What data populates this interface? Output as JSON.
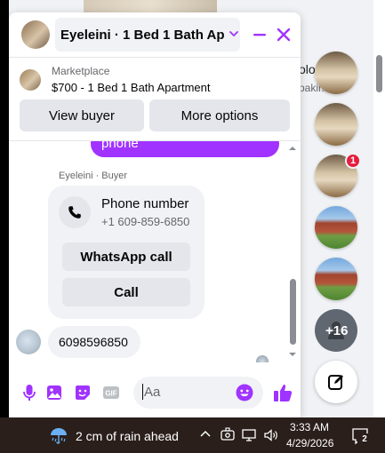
{
  "chat": {
    "title": "Eyeleini · 1 Bed 1 Bath Apa...",
    "listing_source": "Marketplace",
    "listing_title": "$700 - 1 Bed 1 Bath Apartment",
    "view_buyer_label": "View buyer",
    "more_options_label": "More options",
    "outgoing_partial_text": "phone",
    "sender_label": "Eyeleini · Buyer",
    "phone_card": {
      "title": "Phone number",
      "number": "+1 609-859-6850",
      "whatsapp_label": "WhatsApp call",
      "call_label": "Call"
    },
    "incoming_text": "6098596850",
    "input_placeholder": "Aa",
    "accent_color": "#a033ff",
    "icons": [
      "chevron-down-icon",
      "minimize-icon",
      "close-icon",
      "phone-icon",
      "mic-icon",
      "image-icon",
      "sticker-icon",
      "gif-icon",
      "emoji-icon",
      "like-icon"
    ]
  },
  "background": {
    "text_1": "olo",
    "text_2": "pakir....om"
  },
  "chat_heads": {
    "unread_badge": "1",
    "more_count": "+16",
    "icons": [
      "compose-icon",
      "add-person-icon"
    ]
  },
  "taskbar": {
    "weather": "2 cm of rain ahead",
    "time": "3:33 AM",
    "date": "4/29/2026",
    "notification_count": "2",
    "icons": [
      "rain-icon",
      "chevron-up-icon",
      "meet-now-icon",
      "network-icon",
      "volume-icon",
      "notification-icon"
    ]
  }
}
